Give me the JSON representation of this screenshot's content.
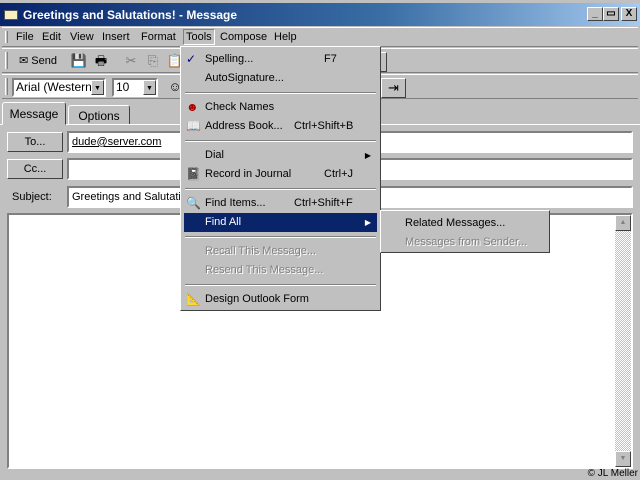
{
  "window": {
    "title": "Greetings and Salutations! - Message",
    "minimize": "_",
    "restore": "▭",
    "close": "X"
  },
  "menubar": [
    "File",
    "Edit",
    "View",
    "Insert",
    "Format",
    "Tools",
    "Compose",
    "Help"
  ],
  "toolbar": {
    "send": "Send",
    "font": "Arial (Western)",
    "size": "10"
  },
  "tabs": [
    "Message",
    "Options"
  ],
  "form": {
    "to_button": "To...",
    "cc_button": "Cc...",
    "subject_label": "Subject:",
    "to_value": "dude@server.com",
    "cc_value": "",
    "subject_value": "Greetings and Salutations!"
  },
  "tools_menu": {
    "spelling": "Spelling...",
    "spelling_sc": "F7",
    "autosig": "AutoSignature...",
    "check": "Check Names",
    "address": "Address Book...",
    "address_sc": "Ctrl+Shift+B",
    "dial": "Dial",
    "journal": "Record in Journal",
    "journal_sc": "Ctrl+J",
    "find_items": "Find Items...",
    "find_items_sc": "Ctrl+Shift+F",
    "find_all": "Find All",
    "recall": "Recall This Message...",
    "resend": "Resend This Message...",
    "design": "Design Outlook Form"
  },
  "find_all_submenu": {
    "related": "Related Messages...",
    "sender": "Messages from Sender..."
  },
  "copyright": "© JL Meller"
}
